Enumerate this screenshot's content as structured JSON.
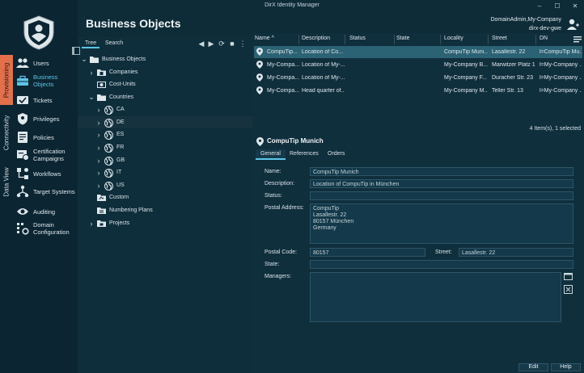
{
  "window": {
    "title": "DirX Identity Manager",
    "minimize": "–",
    "maximize": "☐",
    "close": "✕"
  },
  "header": {
    "page_title": "Business Objects",
    "user": "DomainAdmin,My-Company",
    "server": "dirx-dev-gwe"
  },
  "side_tabs": [
    "Provisioning",
    "Connectivity",
    "Data View"
  ],
  "nav": [
    {
      "label": "Users",
      "icon": "users-icon"
    },
    {
      "label": "Business Objects",
      "icon": "briefcase-icon"
    },
    {
      "label": "Tickets",
      "icon": "tickets-icon"
    },
    {
      "label": "Privileges",
      "icon": "privileges-icon"
    },
    {
      "label": "Policies",
      "icon": "policies-icon"
    },
    {
      "label": "Certification Campaigns",
      "icon": "certification-icon"
    },
    {
      "label": "Workflows",
      "icon": "workflows-icon"
    },
    {
      "label": "Target Systems",
      "icon": "target-systems-icon"
    },
    {
      "label": "Auditing",
      "icon": "eye-icon"
    },
    {
      "label": "Domain Configuration",
      "icon": "domain-config-icon"
    }
  ],
  "tree": {
    "tabs": {
      "tree": "Tree",
      "search": "Search"
    },
    "toolbar": {
      "back": "◀",
      "forward": "▶",
      "refresh": "⟳",
      "stop": "■",
      "more": "⋮"
    },
    "nodes": [
      {
        "label": "Business Objects",
        "level": 0,
        "expanded": "v",
        "icon": "folder-open-icon"
      },
      {
        "label": "Companies",
        "level": 1,
        "expanded": ">",
        "icon": "company-icon"
      },
      {
        "label": "Cost-Units",
        "level": 1,
        "expanded": "",
        "icon": "cost-unit-icon"
      },
      {
        "label": "Countries",
        "level": 1,
        "expanded": "v",
        "icon": "folder-open-icon"
      },
      {
        "label": "CA",
        "level": 2,
        "expanded": ">",
        "icon": "globe-icon"
      },
      {
        "label": "DE",
        "level": 2,
        "expanded": ">",
        "icon": "globe-icon"
      },
      {
        "label": "ES",
        "level": 2,
        "expanded": ">",
        "icon": "globe-icon"
      },
      {
        "label": "FR",
        "level": 2,
        "expanded": ">",
        "icon": "globe-icon"
      },
      {
        "label": "GB",
        "level": 2,
        "expanded": ">",
        "icon": "globe-icon"
      },
      {
        "label": "IT",
        "level": 2,
        "expanded": ">",
        "icon": "globe-icon"
      },
      {
        "label": "US",
        "level": 2,
        "expanded": ">",
        "icon": "globe-icon"
      },
      {
        "label": "Custom",
        "level": 1,
        "expanded": "",
        "icon": "custom-icon"
      },
      {
        "label": "Numbering Plans",
        "level": 1,
        "expanded": "",
        "icon": "numbering-icon"
      },
      {
        "label": "Projects",
        "level": 1,
        "expanded": ">",
        "icon": "projects-icon"
      }
    ]
  },
  "grid": {
    "columns": [
      "Name ^",
      "Description",
      "Status",
      "State",
      "Locality",
      "Street",
      "DN"
    ],
    "rows": [
      {
        "name": "CompuTip...",
        "description": "Location of Co...",
        "status": "",
        "state": "",
        "locality": "CompuTip Muni...",
        "street": "Lasallestr. 22",
        "dn": "l=CompuTip Mu..."
      },
      {
        "name": "My-Compa...",
        "description": "Location of My-...",
        "status": "",
        "state": "",
        "locality": "My-Company B...",
        "street": "Marwitzer Platz 1",
        "dn": "l=My-Company ..."
      },
      {
        "name": "My-Compa...",
        "description": "Location of My-...",
        "status": "",
        "state": "",
        "locality": "My-Company F...",
        "street": "Duracher Str. 23",
        "dn": "l=My-Company ..."
      },
      {
        "name": "My-Compa...",
        "description": "Head quarter of...",
        "status": "",
        "state": "",
        "locality": "My-Company M...",
        "street": "Teller Str. 13",
        "dn": "l=My-Company ..."
      }
    ],
    "status_text": "4 Item(s), 1 selected"
  },
  "detail": {
    "title": "CompuTip Munich",
    "tabs": [
      "General",
      "References",
      "Orders"
    ],
    "labels": {
      "name": "Name:",
      "description": "Description:",
      "status": "Status:",
      "postal_address": "Postal Address:",
      "postal_code": "Postal Code:",
      "street": "Street:",
      "state": "State:",
      "managers": "Managers:"
    },
    "values": {
      "name": "CompuTip Munich",
      "description": "Location of CompuTip in München",
      "status": "",
      "postal_address": "CompuTip\nLasallestr. 22\n80157 München\nGermany",
      "postal_code": "80157",
      "street": "Lasallestr. 22",
      "state": "",
      "managers": ""
    },
    "buttons": {
      "edit": "Edit",
      "help": "Help"
    }
  },
  "colors": {
    "accent": "#5ec4e6",
    "provisioning_tab": "#e4704b",
    "selected_row": "#2b6274",
    "background": "#0e2b38"
  }
}
